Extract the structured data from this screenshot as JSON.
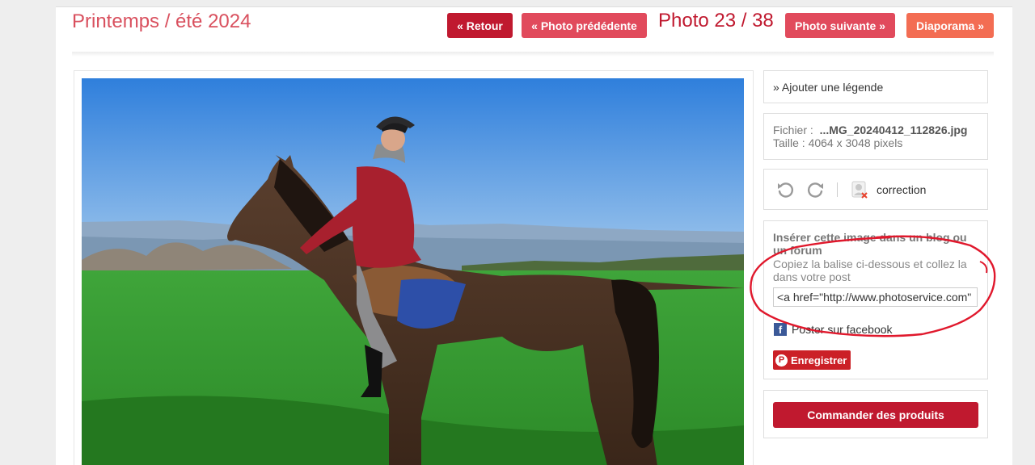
{
  "header": {
    "album_title": "Printemps / été 2024",
    "back_label": "« Retour",
    "prev_label": "« Photo prédédente",
    "counter": "Photo 23 / 38",
    "next_label": "Photo suivante »",
    "slideshow_label": "Diaporama »"
  },
  "sidebar": {
    "legend_link": "» Ajouter une légende",
    "file_label": "Fichier :",
    "file_name": "...MG_20240412_112826.jpg",
    "size_line": "Taille : 4064 x 3048 pixels",
    "correction_label": "correction",
    "embed_title": "Insérer cette image dans un blog ou un forum",
    "embed_hint": "Copiez la balise ci-dessous et collez la dans votre post",
    "embed_code": "<a href=\"http://www.photoservice.com\" t",
    "facebook_label": "Poster sur facebook",
    "pinterest_label": "Enregistrer",
    "order_label": "Commander des produits"
  },
  "icons": [
    "undo-icon",
    "redo-icon",
    "correction-icon",
    "facebook-icon",
    "pinterest-icon"
  ],
  "colors": {
    "accent": "#c0192f",
    "accent_light": "#e14a5c",
    "slideshow": "#f36d53",
    "title": "#d9505e",
    "annotation": "#e0182c"
  }
}
